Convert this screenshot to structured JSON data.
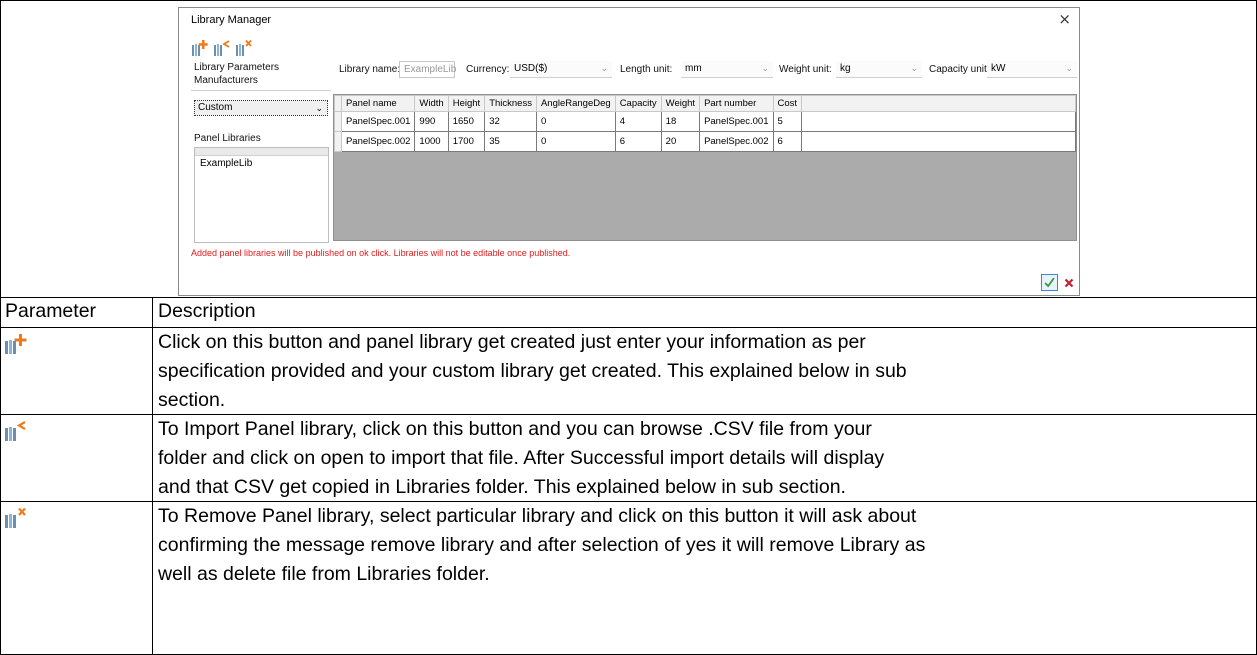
{
  "dialog": {
    "title": "Library Manager",
    "close_glyph": "×",
    "toolbar": [
      {
        "icon": "add-library-icon"
      },
      {
        "icon": "import-library-icon"
      },
      {
        "icon": "remove-library-icon"
      }
    ],
    "left": {
      "tab_label": "Library Parameters",
      "manufacturers_label": "Manufacturers",
      "manufacturer_value": "Custom",
      "panel_libraries_label": "Panel Libraries",
      "libraries": [
        "ExampleLib"
      ]
    },
    "params": {
      "library_name_label": "Library name:",
      "library_name_value": "ExampleLib",
      "currency_label": "Currency:",
      "currency_value": "USD($)",
      "length_unit_label": "Length unit:",
      "length_unit_value": "mm",
      "weight_unit_label": "Weight unit:",
      "weight_unit_value": "kg",
      "capacity_unit_label": "Capacity unit:",
      "capacity_unit_value": "kW"
    },
    "grid": {
      "columns": [
        "Panel name",
        "Width",
        "Height",
        "Thickness",
        "AngleRangeDeg",
        "Capacity",
        "Weight",
        "Part number",
        "Cost"
      ],
      "rows": [
        [
          "PanelSpec.001",
          "990",
          "1650",
          "32",
          "0",
          "4",
          "18",
          "PanelSpec.001",
          "5"
        ],
        [
          "PanelSpec.002",
          "1000",
          "1700",
          "35",
          "0",
          "6",
          "20",
          "PanelSpec.002",
          "6"
        ]
      ]
    },
    "notice": "Added panel libraries will be published on ok click. Libraries will not be editable once published.",
    "ok_icon": "checkmark-icon",
    "cancel_icon": "red-x-icon",
    "colors": {
      "notice": "#e21a1a",
      "ok": "#2e9e3a",
      "cancel": "#c0242c",
      "icon_orange": "#f07a1a"
    }
  },
  "doc": {
    "header": {
      "parameter": "Parameter",
      "description": "Description"
    },
    "rows": [
      {
        "icon": "add-library-icon",
        "lines": [
          "Click on this button and panel library get created just enter your information as per",
          "specification provided and your custom library get created. This explained below in sub",
          "section."
        ]
      },
      {
        "icon": "import-library-icon",
        "lines": [
          "To Import Panel library, click on this button and you can browse .CSV file from your",
          "folder and click on open to import that file. After Successful import details will display",
          "and that CSV get copied in Libraries folder. This explained below in sub section."
        ]
      },
      {
        "icon": "remove-library-icon",
        "lines": [
          "To Remove Panel library, select particular library and click on this button it will ask about",
          "confirming the message remove library and after selection of yes it will remove Library as",
          "well as delete file from Libraries folder."
        ]
      }
    ]
  }
}
